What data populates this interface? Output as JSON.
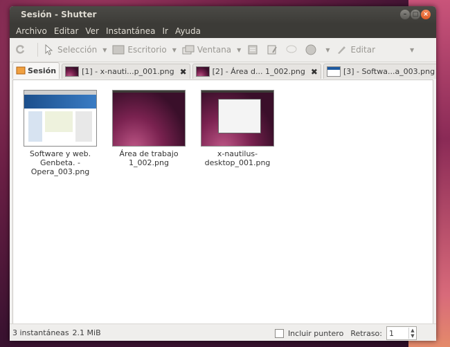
{
  "window": {
    "title": "Sesión - Shutter"
  },
  "menu": [
    "Archivo",
    "Editar",
    "Ver",
    "Instantánea",
    "Ir",
    "Ayuda"
  ],
  "toolbar": {
    "selection": "Selección",
    "desktop": "Escritorio",
    "window": "Ventana",
    "edit": "Editar"
  },
  "tabs": [
    {
      "label": "Sesión",
      "active": true
    },
    {
      "label": "[1] - x-nauti...p_001.png"
    },
    {
      "label": "[2] - Área d... 1_002.png"
    },
    {
      "label": "[3] - Softwa...a_003.png"
    }
  ],
  "items": [
    {
      "caption_lines": [
        "Software y web.",
        "Genbeta. -",
        "Opera_003.png"
      ]
    },
    {
      "caption_lines": [
        "Área de trabajo",
        "1_002.png"
      ]
    },
    {
      "caption_lines": [
        "x-nautilus-",
        "desktop_001.png"
      ]
    }
  ],
  "status": {
    "count": "3 instantáneas",
    "size": "2.1 MiB",
    "include_pointer": "Incluir puntero",
    "delay_label": "Retraso:",
    "delay_value": "1"
  },
  "colors": {
    "titlebar": "#3c3b37",
    "close_button": "#e05a24"
  }
}
